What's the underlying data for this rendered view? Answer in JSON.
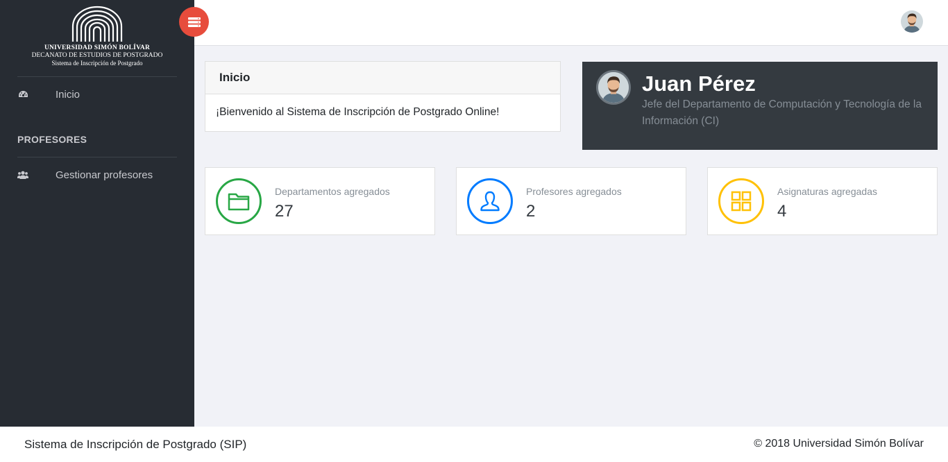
{
  "sidebar": {
    "logo": {
      "line1": "UNIVERSIDAD SIMÓN BOLÍVAR",
      "line2": "DECANATO DE ESTUDIOS DE POSTGRADO",
      "line3": "Sistema de Inscripción de Postgrado"
    },
    "items": [
      {
        "label": "Inicio",
        "icon": "dashboard-icon"
      },
      {
        "label": "Gestionar profesores",
        "icon": "users-icon"
      }
    ],
    "section_title": "PROFESORES"
  },
  "welcome": {
    "title": "Inicio",
    "message": "¡Bienvenido al Sistema de Inscripción de Postgrado Online!"
  },
  "profile": {
    "name": "Juan Pérez",
    "role": "Jefe del Departamento de Computación y Tecnología de la Información (CI)"
  },
  "stats": [
    {
      "label": "Departamentos agregados",
      "value": "27",
      "icon": "folder-icon",
      "color": "#28a745"
    },
    {
      "label": "Profesores agregados",
      "value": "2",
      "icon": "user-icon",
      "color": "#007bff"
    },
    {
      "label": "Asignaturas agregadas",
      "value": "4",
      "icon": "grid-icon",
      "color": "#ffc107"
    }
  ],
  "footer": {
    "left": "Sistema de Inscripción de Postgrado (SIP)",
    "right": "© 2018 Universidad Simón Bolívar"
  },
  "colors": {
    "sidebar_bg": "#272c33",
    "toggle_button": "#e74c3c",
    "profile_bg": "#343a40"
  }
}
